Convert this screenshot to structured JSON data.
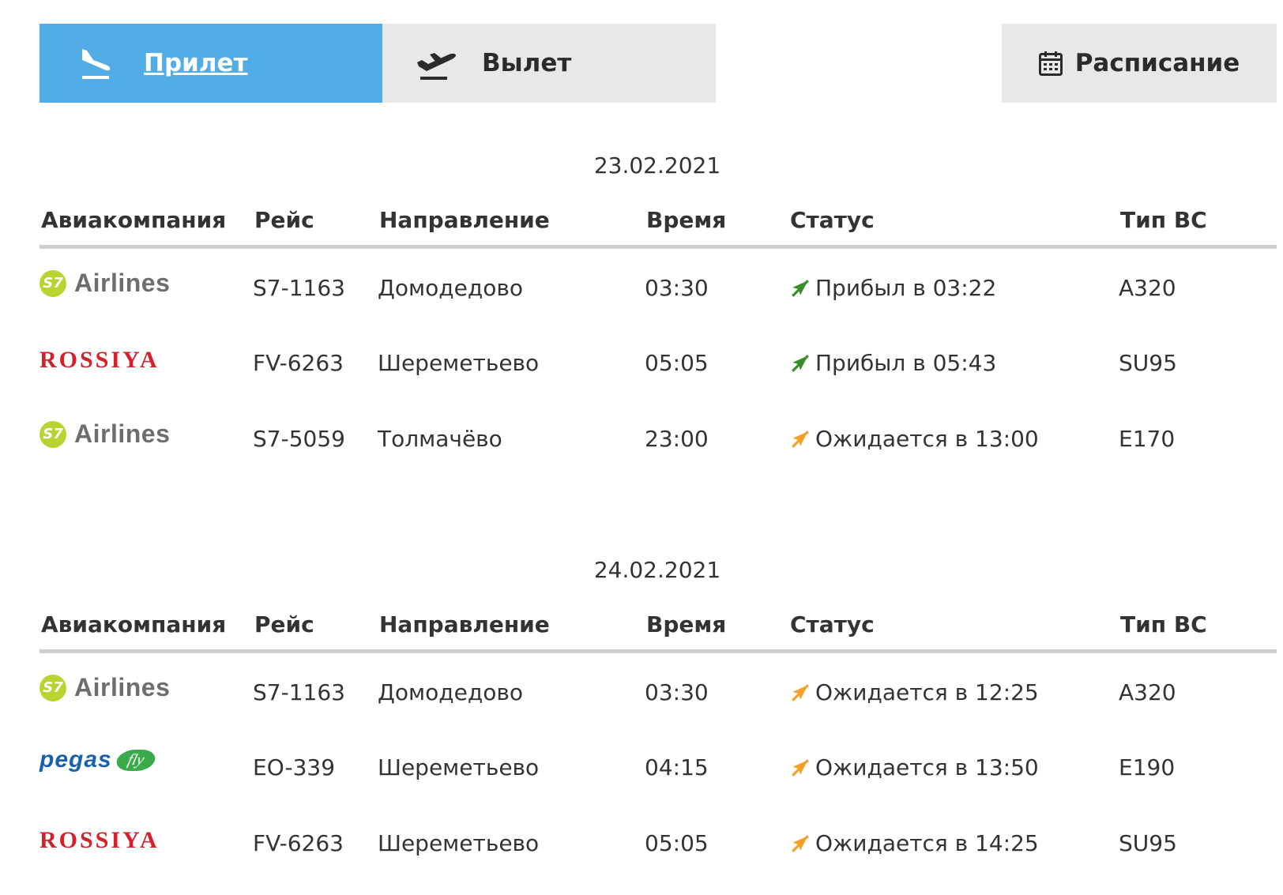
{
  "tabs": {
    "arrival_label": "Прилет",
    "departure_label": "Вылет",
    "schedule_label": "Расписание"
  },
  "headers": {
    "airline": "Авиакомпания",
    "flight": "Рейс",
    "direction": "Направление",
    "time": "Время",
    "status": "Статус",
    "aircraft": "Тип ВС"
  },
  "colors": {
    "active_tab": "#52ace5",
    "inactive_tab": "#e8e8e8",
    "arrived": "#3b8c2a",
    "expected": "#f2a22b"
  },
  "days": [
    {
      "date": "23.02.2021",
      "flights": [
        {
          "airline_logo_text": "Airlines",
          "airline_badge": "S7",
          "flight": "S7-1163",
          "direction": "Домодедово",
          "time": "03:30",
          "status": "Прибыл в 03:22",
          "status_kind": "arrived",
          "aircraft": "A320"
        },
        {
          "airline_logo_text": "ROSSIYA",
          "flight": "FV-6263",
          "direction": "Шереметьево",
          "time": "05:05",
          "status": "Прибыл в 05:43",
          "status_kind": "arrived",
          "aircraft": "SU95"
        },
        {
          "airline_logo_text": "Airlines",
          "airline_badge": "S7",
          "flight": "S7-5059",
          "direction": "Толмачёво",
          "time": "23:00",
          "status": "Ожидается в 13:00",
          "status_kind": "expected",
          "aircraft": "E170"
        }
      ]
    },
    {
      "date": "24.02.2021",
      "flights": [
        {
          "airline_logo_text": "Airlines",
          "airline_badge": "S7",
          "flight": "S7-1163",
          "direction": "Домодедово",
          "time": "03:30",
          "status": "Ожидается в 12:25",
          "status_kind": "expected",
          "aircraft": "A320"
        },
        {
          "airline_logo_text": "pegas",
          "airline_logo_sub": "fly",
          "flight": "EO-339",
          "direction": "Шереметьево",
          "time": "04:15",
          "status": "Ожидается в 13:50",
          "status_kind": "expected",
          "aircraft": "E190"
        },
        {
          "airline_logo_text": "ROSSIYA",
          "flight": "FV-6263",
          "direction": "Шереметьево",
          "time": "05:05",
          "status": "Ожидается в 14:25",
          "status_kind": "expected",
          "aircraft": "SU95"
        }
      ]
    }
  ]
}
